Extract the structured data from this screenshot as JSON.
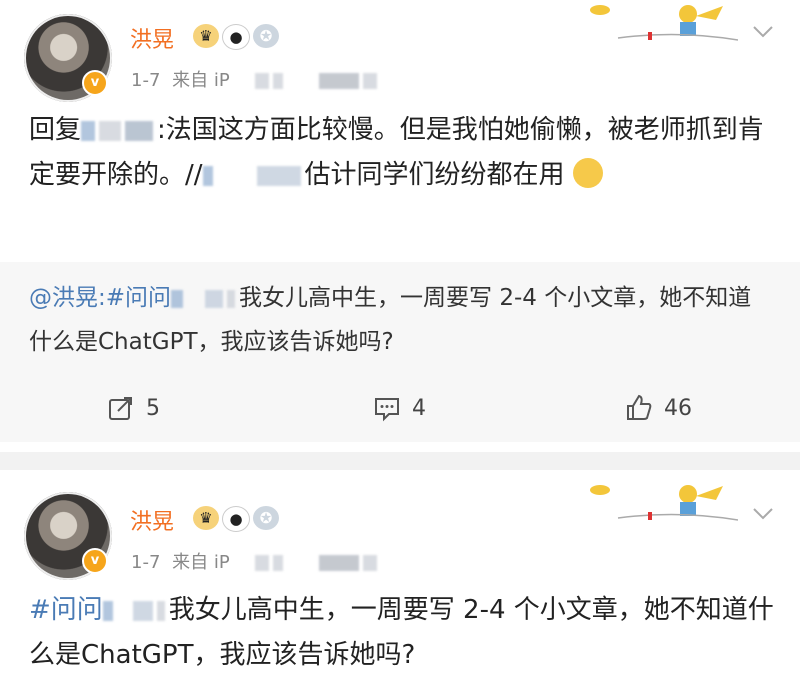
{
  "posts": [
    {
      "author": "洪晃",
      "verified_mark": "v",
      "date": "1-7",
      "source_prefix": "来自 iP",
      "badges": [
        "crown-badge",
        "panda-badge",
        "medal-badge"
      ],
      "body": {
        "reply_label": "回复",
        "reply_rest": ":法国这方面比较慢。但是我怕她偷懒，被老师抓到肯定要开除的。//",
        "reply_tail": "估计同学们纷纷都在用"
      },
      "quote": {
        "prefix": "@洪晃:",
        "hashtag": "#问问",
        "text": "我女儿高中生，一周要写 2-4 个小文章，她不知道什么是ChatGPT，我应该告诉她吗?"
      },
      "actions": {
        "share": "5",
        "comment": "4",
        "like": "46"
      }
    },
    {
      "author": "洪晃",
      "verified_mark": "v",
      "date": "1-7",
      "source_prefix": "来自 iP",
      "badges": [
        "crown-badge",
        "panda-badge",
        "medal-badge"
      ],
      "body": {
        "hashtag": "#问问",
        "text": "我女儿高中生，一周要写 2-4 个小文章，她不知道什么是ChatGPT，我应该告诉她吗?"
      }
    }
  ],
  "colors": {
    "name": "#f26f22",
    "link": "#4a7bb5",
    "quote_bg": "#f7f7f7",
    "divider": "#f2f2f2"
  },
  "icons": {
    "share": "share-icon",
    "comment": "comment-icon",
    "like": "like-icon",
    "more": "chevron-down-icon"
  }
}
